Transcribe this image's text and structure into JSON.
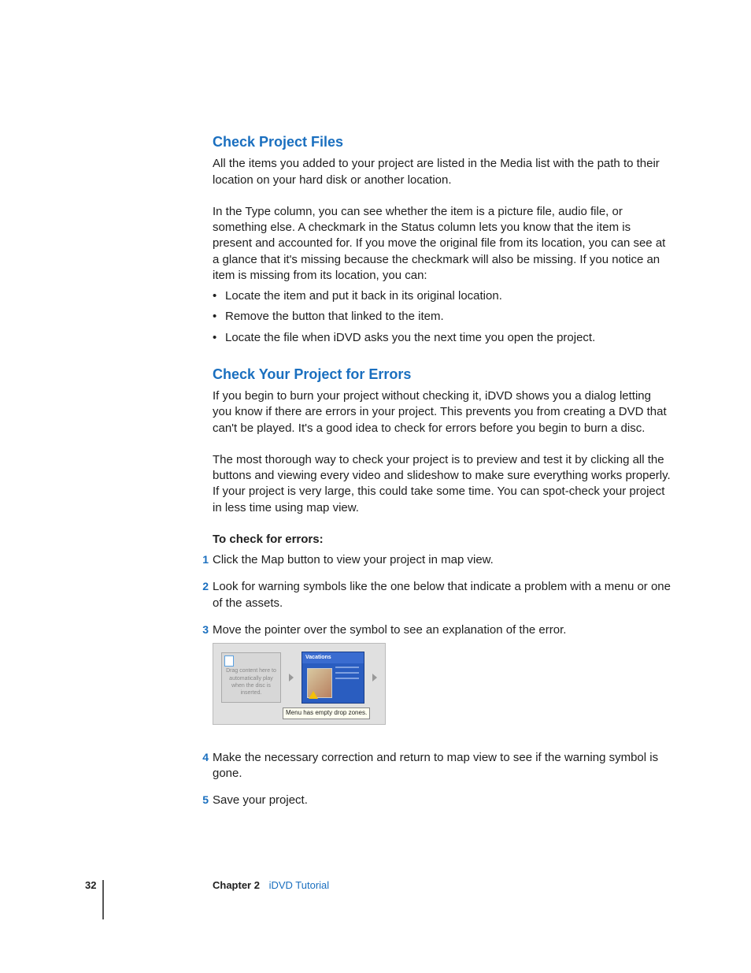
{
  "section1": {
    "heading": "Check Project Files",
    "p1": "All the items you added to your project are listed in the Media list with the path to their location on your hard disk or another location.",
    "p2": "In the Type column, you can see whether the item is a picture file, audio file, or something else. A checkmark in the Status column lets you know that the item is present and accounted for. If you move the original file from its location, you can see at a glance that it's missing because the checkmark will also be missing. If you notice an item is missing from its location, you can:",
    "bullets": [
      "Locate the item and put it back in its original location.",
      "Remove the button that linked to the item.",
      "Locate the file when iDVD asks you the next time you open the project."
    ]
  },
  "section2": {
    "heading": "Check Your Project for Errors",
    "p1": "If you begin to burn your project without checking it, iDVD shows you a dialog letting you know if there are errors in your project. This prevents you from creating a DVD that can't be played. It's a good idea to check for errors before you begin to burn a disc.",
    "p2": "The most thorough way to check your project is to preview and test it by clicking all the buttons and viewing every video and slideshow to make sure everything works properly. If your project is very large, this could take some time. You can spot-check your project in less time using map view.",
    "subhead": "To check for errors:",
    "steps": [
      "Click the Map button to view your project in map view.",
      "Look for warning symbols like the one below that indicate a problem with a menu or one of the assets.",
      "Move the pointer over the symbol to see an explanation of the error.",
      "Make the necessary correction and return to map view to see if the warning symbol is gone.",
      "Save your project."
    ]
  },
  "figure": {
    "left_text": "Drag content here to automatically play when the disc is inserted.",
    "right_title": "Vacations",
    "tooltip": "Menu has empty drop zones."
  },
  "footer": {
    "page": "32",
    "chapter": "Chapter 2",
    "title": "iDVD Tutorial"
  }
}
